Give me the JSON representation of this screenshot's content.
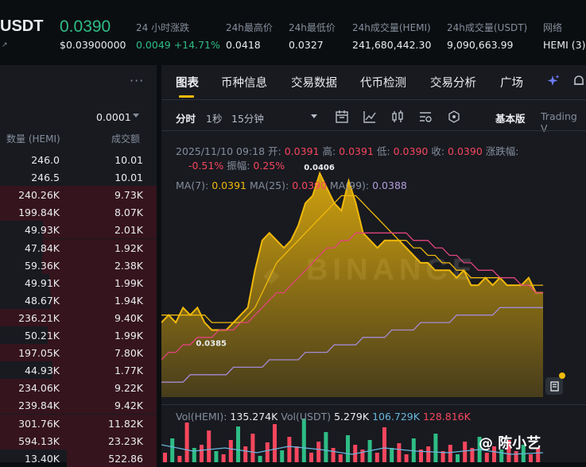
{
  "header": {
    "pair": "USDT",
    "pair_sub": "↗",
    "price": "0.0390",
    "price_usd": "$0.03900000",
    "stats": [
      {
        "label": "24 小时涨跌",
        "value": "0.0049 +14.71%",
        "color": "#2ebd85"
      },
      {
        "label": "24h最高价",
        "value": "0.0418"
      },
      {
        "label": "24h最低价",
        "value": "0.0327"
      },
      {
        "label": "24h成交量(HEMI)",
        "value": "241,680,442.30"
      },
      {
        "label": "24h成交量(USDT)",
        "value": "9,090,663.99"
      },
      {
        "label": "网络",
        "value": "HEMI (3)"
      }
    ]
  },
  "orderbook": {
    "menu": "···",
    "precision": "0.0001",
    "col_qty": "数量 (HEMI)",
    "col_total": "成交额",
    "rows": [
      {
        "qty": "246.0",
        "total": "10.01",
        "depth": 0
      },
      {
        "qty": "246.5",
        "total": "10.01",
        "depth": 0
      },
      {
        "qty": "240.26K",
        "total": "9.73K",
        "depth": 1.0
      },
      {
        "qty": "199.84K",
        "total": "8.07K",
        "depth": 1.0
      },
      {
        "qty": "49.93K",
        "total": "2.01K",
        "depth": 0.55
      },
      {
        "qty": "47.84K",
        "total": "1.92K",
        "depth": 0.55
      },
      {
        "qty": "59.36K",
        "total": "2.38K",
        "depth": 0.56
      },
      {
        "qty": "49.91K",
        "total": "1.99K",
        "depth": 0.48
      },
      {
        "qty": "48.67K",
        "total": "1.94K",
        "depth": 0.47
      },
      {
        "qty": "236.21K",
        "total": "9.40K",
        "depth": 1.0
      },
      {
        "qty": "50.21K",
        "total": "1.99K",
        "depth": 0.5
      },
      {
        "qty": "197.05K",
        "total": "7.80K",
        "depth": 1.0
      },
      {
        "qty": "44.93K",
        "total": "1.77K",
        "depth": 0.45
      },
      {
        "qty": "234.06K",
        "total": "9.22K",
        "depth": 1.0
      },
      {
        "qty": "239.84K",
        "total": "9.42K",
        "depth": 1.0
      },
      {
        "qty": "301.76K",
        "total": "11.82K",
        "depth": 1.0
      },
      {
        "qty": "594.13K",
        "total": "23.23K",
        "depth": 1.0
      },
      {
        "qty": "13.40K",
        "total": "522.86",
        "depth": 0.3
      }
    ]
  },
  "tabs": [
    "图表",
    "币种信息",
    "交易数据",
    "代币检测",
    "交易分析",
    "广场"
  ],
  "toolbar": {
    "time": "分时",
    "t1": "1秒",
    "t2": "15分钟",
    "version": "基本版",
    "trading_view": "Trading V"
  },
  "chart_info": {
    "date": "2025/11/10 09:18",
    "open_label": "开:",
    "open": "0.0391",
    "high_label": "高:",
    "high": "0.0391",
    "low_label": "低:",
    "low": "0.0390",
    "close_label": "收:",
    "close": "0.0390",
    "change_label": "涨跌幅:",
    "change": "-0.51%",
    "amp_label": "振幅:",
    "amp": "0.25%"
  },
  "ma": {
    "ma7_label": "MA(7):",
    "ma7": "0.0391",
    "ma25_label": "MA(25):",
    "ma25": "0.0390",
    "ma99_label": "MA(99):",
    "ma99": "0.0388"
  },
  "chart_marks": {
    "high": "0.0406",
    "low": "0.0385"
  },
  "volume": {
    "label1": "Vol(HEMI):",
    "val1": "135.274K",
    "label2": "Vol(USDT)",
    "val2": "5.279K",
    "val3": "106.729K",
    "val4": "128.816K"
  },
  "watermark": "@ 陈小艺",
  "chart_data": {
    "type": "area",
    "series": [
      {
        "values": [
          0.0386,
          0.0387,
          0.0386,
          0.0388,
          0.0387,
          0.0388,
          0.0386,
          0.0385,
          0.0385,
          0.0385,
          0.0386,
          0.0387,
          0.0388,
          0.0393,
          0.0397,
          0.0398,
          0.0397,
          0.0396,
          0.0397,
          0.0399,
          0.0402,
          0.0403,
          0.0406,
          0.0404,
          0.0402,
          0.0401,
          0.0405,
          0.0402,
          0.0398,
          0.0397,
          0.0396,
          0.0397,
          0.0397,
          0.0397,
          0.0396,
          0.0395,
          0.0394,
          0.0394,
          0.0393,
          0.0393,
          0.0393,
          0.0392,
          0.0393,
          0.0391,
          0.0391,
          0.0392,
          0.0391,
          0.0392,
          0.0391,
          0.0391,
          0.0391,
          0.0392,
          0.039,
          0.039
        ]
      },
      {
        "name": "MA(7)",
        "values": [
          0.0387,
          0.0387,
          0.0387,
          0.0387,
          0.0387,
          0.0387,
          0.0387,
          0.0386,
          0.0386,
          0.0386,
          0.0386,
          0.0386,
          0.0387,
          0.0388,
          0.039,
          0.0392,
          0.0394,
          0.0395,
          0.0396,
          0.0397,
          0.0398,
          0.0399,
          0.04,
          0.0401,
          0.0402,
          0.0403,
          0.0403,
          0.0403,
          0.0402,
          0.0401,
          0.04,
          0.0399,
          0.0398,
          0.0397,
          0.0397,
          0.0396,
          0.0396,
          0.0395,
          0.0395,
          0.0394,
          0.0394,
          0.0393,
          0.0393,
          0.0392,
          0.0392,
          0.0392,
          0.0392,
          0.0392,
          0.0391,
          0.0391,
          0.0391,
          0.0391,
          0.0391,
          0.0391
        ]
      },
      {
        "name": "MA(25)",
        "values": [
          0.0381,
          0.0382,
          0.0382,
          0.0383,
          0.0383,
          0.0384,
          0.0384,
          0.0384,
          0.0385,
          0.0385,
          0.0385,
          0.0386,
          0.0386,
          0.0387,
          0.0388,
          0.0389,
          0.039,
          0.039,
          0.0391,
          0.0392,
          0.0393,
          0.0394,
          0.0395,
          0.0396,
          0.0396,
          0.0397,
          0.0397,
          0.0398,
          0.0398,
          0.0398,
          0.0398,
          0.0398,
          0.0398,
          0.0398,
          0.0398,
          0.0397,
          0.0397,
          0.0397,
          0.0396,
          0.0396,
          0.0395,
          0.0395,
          0.0394,
          0.0394,
          0.0393,
          0.0393,
          0.0393,
          0.0392,
          0.0392,
          0.0392,
          0.0391,
          0.0391,
          0.039,
          0.039
        ]
      },
      {
        "name": "MA(99)",
        "values": [
          0.0378,
          0.0378,
          0.0378,
          0.0378,
          0.0379,
          0.0379,
          0.0379,
          0.0379,
          0.0379,
          0.0379,
          0.038,
          0.038,
          0.038,
          0.038,
          0.038,
          0.0381,
          0.0381,
          0.0381,
          0.0381,
          0.0381,
          0.0382,
          0.0382,
          0.0382,
          0.0382,
          0.0383,
          0.0383,
          0.0383,
          0.0383,
          0.0384,
          0.0384,
          0.0384,
          0.0384,
          0.0385,
          0.0385,
          0.0385,
          0.0385,
          0.0386,
          0.0386,
          0.0386,
          0.0386,
          0.0386,
          0.0387,
          0.0387,
          0.0387,
          0.0387,
          0.0387,
          0.0387,
          0.0388,
          0.0388,
          0.0388,
          0.0388,
          0.0388,
          0.0388,
          0.0388
        ]
      }
    ],
    "ylim": [
      0.0376,
      0.0409
    ],
    "colors": {
      "area": "#f0b90b",
      "ma7": "#f0b90b",
      "ma25": "#e0447c",
      "ma99": "#a48ad6"
    }
  }
}
